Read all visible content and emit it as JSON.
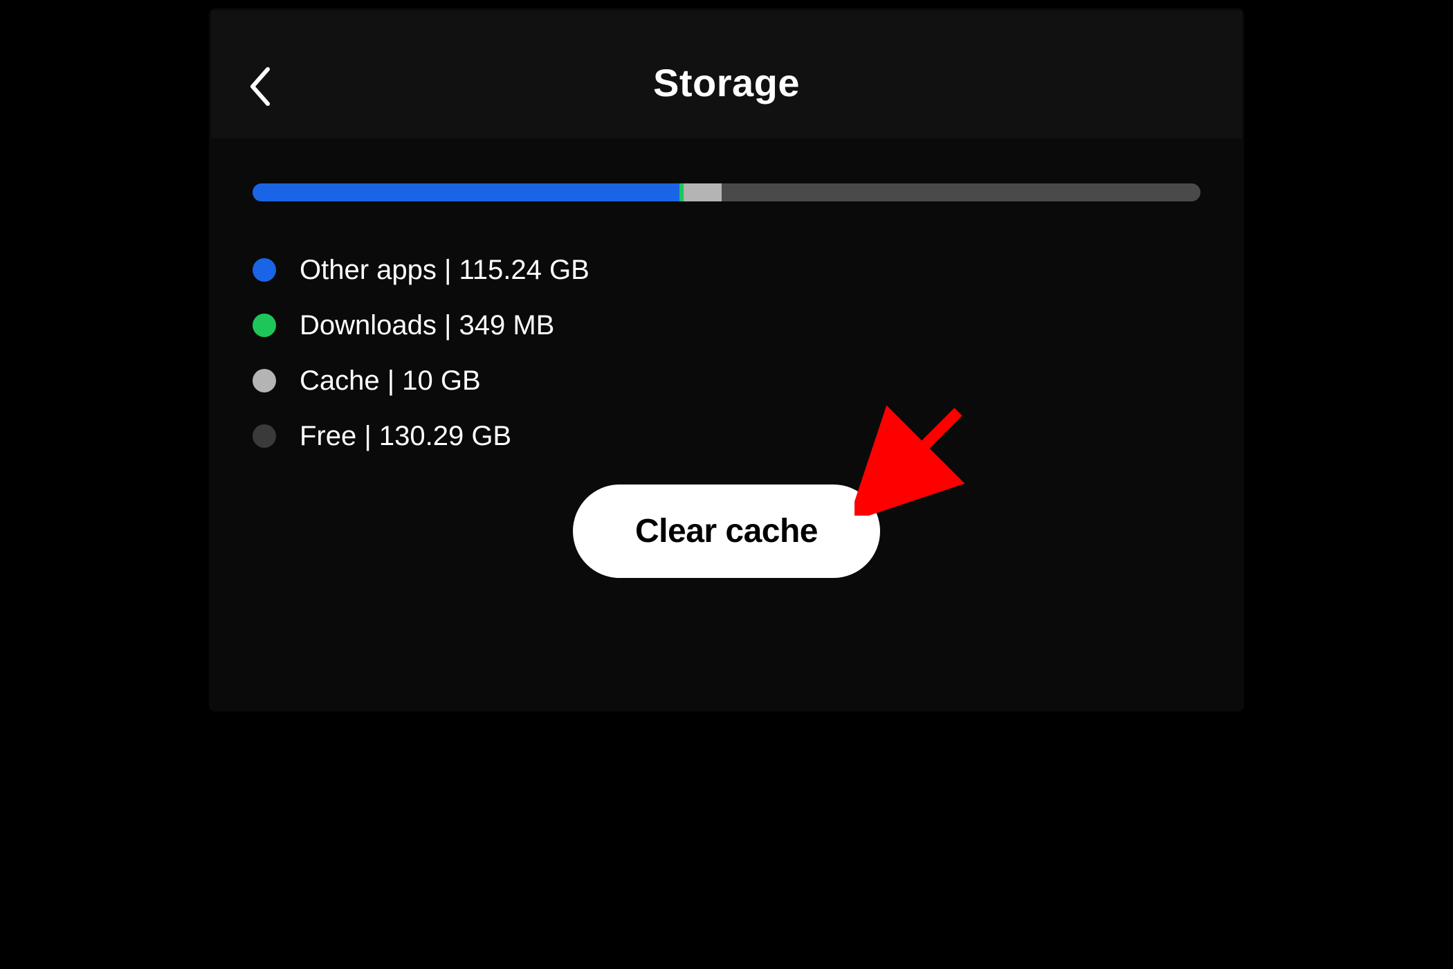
{
  "header": {
    "title": "Storage",
    "back_icon": "chevron-left"
  },
  "storage_bar": {
    "segments": [
      {
        "key": "otherapps",
        "percent": 45.0
      },
      {
        "key": "downloads",
        "percent": 0.5
      },
      {
        "key": "cache",
        "percent": 4.0
      },
      {
        "key": "free",
        "percent": 50.5
      }
    ]
  },
  "legend": [
    {
      "key": "otherapps",
      "text": "Other apps | 115.24 GB"
    },
    {
      "key": "downloads",
      "text": "Downloads | 349 MB"
    },
    {
      "key": "cache",
      "text": "Cache | 10 GB"
    },
    {
      "key": "free",
      "text": "Free | 130.29 GB"
    }
  ],
  "button": {
    "clear_cache_label": "Clear cache"
  },
  "colors": {
    "otherapps": "#1a64e6",
    "downloads": "#1ec65a",
    "cache": "#b4b4b4",
    "free": "#4a4a4a",
    "annotation_arrow": "#ff0000"
  },
  "annotation": {
    "type": "arrow",
    "points_to": "clear-cache-button"
  }
}
